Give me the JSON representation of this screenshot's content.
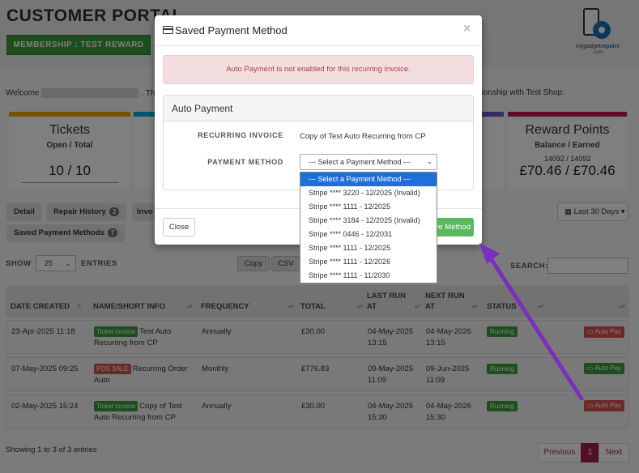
{
  "portal": {
    "title": "CUSTOMER PORTAL",
    "membership": "MEMBERSHIP : TEST REWARD",
    "logo_brand_a": "mygadget",
    "logo_brand_b": "repairs",
    "logo_com": ".com",
    "welcome_text": "Welcome",
    "welcome_tail": "tionship with Test Shop.",
    "welcome_dot": ". This"
  },
  "stats": {
    "tickets": {
      "title": "Tickets",
      "sub": "Open / Total",
      "value": "10 / 10",
      "color": "#f0a30a"
    },
    "reward": {
      "title": "Reward Points",
      "sub": "Balance / Earned",
      "small": "14092 / 14092",
      "value": "£70.46 / £70.46",
      "color": "#c2185b"
    },
    "card2_color": "#00aadd",
    "card3_color": "#6a5acd"
  },
  "tabs": {
    "detail": "Detail",
    "repair_history": "Repair History",
    "repair_history_count": "2",
    "invoices": "Invo",
    "saved_payment": "Saved Payment Methods",
    "saved_payment_count": "7",
    "range": "Last 30 Days"
  },
  "table_controls": {
    "show": "SHOW",
    "show_value": "25",
    "entries": "ENTRIES",
    "copy": "Copy",
    "csv": "CSV",
    "search": "SEARCH:"
  },
  "table": {
    "headers": [
      "DATE CREATED",
      "NAME/SHORT INFO",
      "FREQUENCY",
      "TOTAL",
      "LAST RUN AT",
      "NEXT RUN AT",
      "STATUS"
    ],
    "header_lines": {
      "last_run_1": "LAST RUN",
      "last_run_2": "AT",
      "next_run_1": "NEXT RUN",
      "next_run_2": "AT"
    },
    "rows": [
      {
        "date": "23-Apr-2025 11:18",
        "tag": "Ticket invoice",
        "name1": "Test Auto",
        "name2": "Recurring from CP",
        "freq": "Annually",
        "total": "£30.00",
        "last1": "04-May-2025",
        "last2": "13:15",
        "next1": "04-May-2026",
        "next2": "13:15",
        "status": "Running",
        "autopay": "Auto Pay"
      },
      {
        "date": "07-May-2025 09:25",
        "tag": "POS SALE",
        "name1": "Recurring Order",
        "name2": "Auto",
        "freq": "Monthly",
        "total": "£776.83",
        "last1": "09-May-2025",
        "last2": "11:09",
        "next1": "09-Jun-2025",
        "next2": "11:09",
        "status": "Running",
        "autopay": "Auto Pay"
      },
      {
        "date": "02-May-2025 15:24",
        "tag": "Ticket invoice",
        "name1": "Copy of Test",
        "name2": "Auto Recurring from CP",
        "freq": "Annually",
        "total": "£30.00",
        "last1": "04-May-2025",
        "last2": "15:30",
        "next1": "04-May-2026",
        "next2": "15:30",
        "status": "Running",
        "autopay": "Auto Pay"
      }
    ]
  },
  "footer": {
    "showing": "Showing 1 to 3 of 3 entries",
    "previous": "Previous",
    "page": "1",
    "next": "Next"
  },
  "modal": {
    "title": "Saved Payment Method",
    "close_x": "×",
    "alert": "Auto Payment is not enabled for this recurring invoice.",
    "panel_title": "Auto Payment",
    "recurring_label": "RECURRING INVOICE",
    "recurring_value": "Copy of Test Auto Recurring from CP",
    "payment_label": "PAYMENT METHOD",
    "select_value": "--- Select a Payment Method ---",
    "close_button": "Close",
    "save_button": "Save Method",
    "options": [
      "--- Select a Payment Method ---",
      "Stripe **** 3220 - 12/2025 (Invalid)",
      "Stripe **** 1111 - 12/2025",
      "Stripe **** 3184 - 12/2025 (Invalid)",
      "Stripe **** 0446 - 12/2031",
      "Stripe **** 1111 - 12/2025",
      "Stripe **** 1111 - 12/2026",
      "Stripe **** 1111 - 11/2030"
    ]
  },
  "colors": {
    "accent_green": "#3d9c3d",
    "danger": "#d9534f",
    "highlight_blue": "#1e6fd9",
    "arrow_purple": "#7b2fbf",
    "pager_accent": "#a3224a"
  }
}
